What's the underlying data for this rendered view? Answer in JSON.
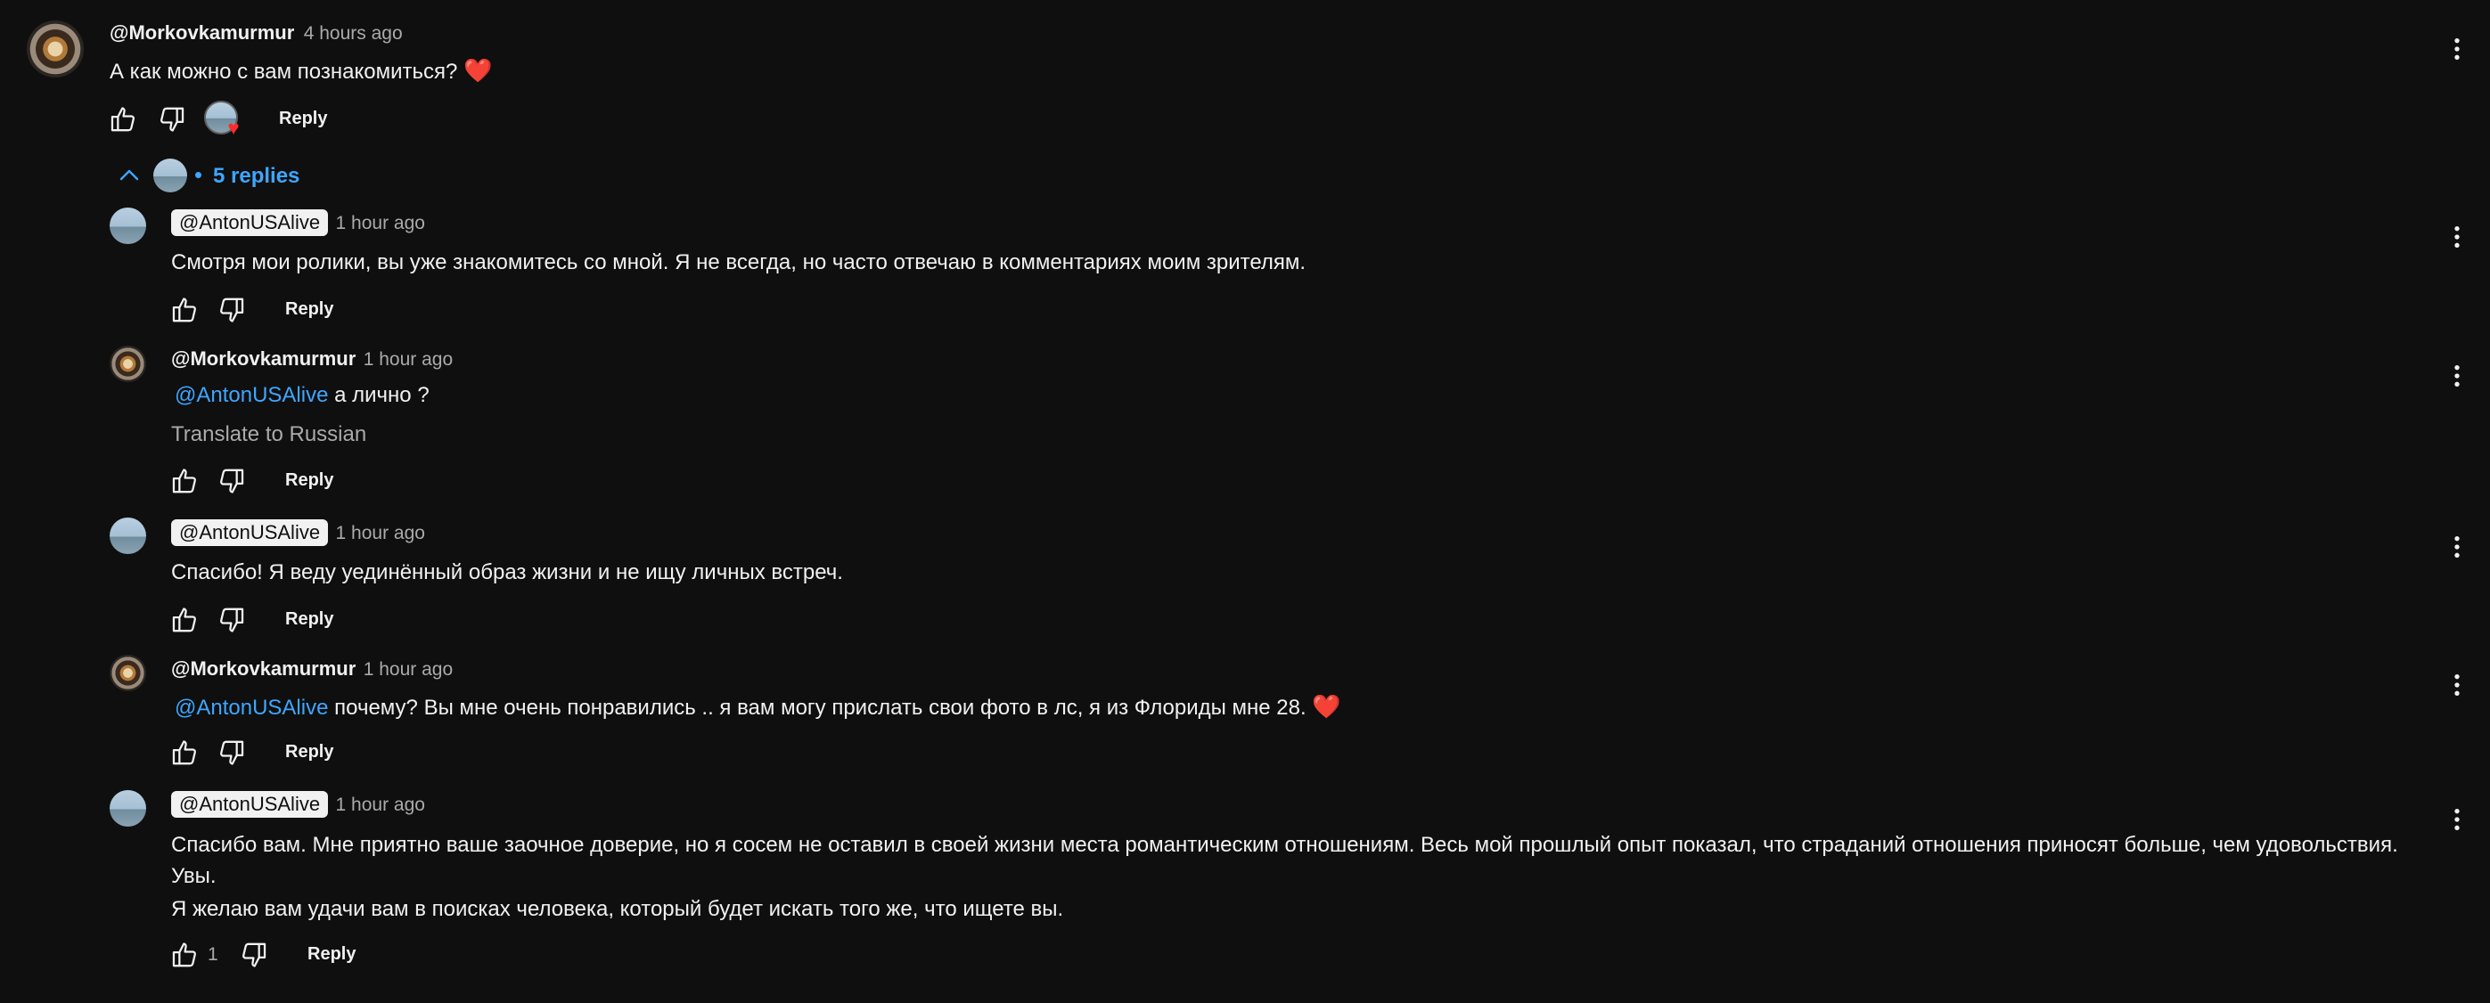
{
  "top_comment": {
    "author": "@Morkovkamurmur",
    "time": "4 hours ago",
    "text": "А как можно с вам познакомиться?",
    "emoji": "❤️",
    "reply_label": "Reply"
  },
  "replies_toggle": {
    "label": "5 replies"
  },
  "replies": [
    {
      "author": "@AntonUSAlive",
      "time": "1 hour ago",
      "text": "Смотря мои ролики, вы уже знакомитесь со мной. Я не всегда, но часто отвечаю в комментариях моим зрителям.",
      "reply_label": "Reply"
    },
    {
      "author": "@Morkovkamurmur",
      "time": "1 hour ago",
      "mention": "@AntonUSAlive",
      "text": " а лично ?",
      "translate": "Translate to Russian",
      "reply_label": "Reply"
    },
    {
      "author": "@AntonUSAlive",
      "time": "1 hour ago",
      "text": "Спасибо! Я веду уединённый образ жизни и не ищу личных встреч.",
      "reply_label": "Reply"
    },
    {
      "author": "@Morkovkamurmur",
      "time": "1 hour ago",
      "mention": "@AntonUSAlive",
      "text": " почему? Вы мне очень понравились .. я вам могу прислать свои фото в лс, я из Флориды мне 28.",
      "emoji": "❤️",
      "reply_label": "Reply"
    },
    {
      "author": "@AntonUSAlive",
      "time": "1 hour ago",
      "text_line1": "Спасибо вам. Мне приятно ваше заочное доверие, но я сосем не оставил в своей жизни места романтическим отношениям. Весь мой прошлый опыт показал, что страданий отношения приносят больше, чем удовольствия.",
      "text_line2": "Увы.",
      "text_line3": "Я желаю вам удачи вам в поисках человека, который будет искать того же, что ищете вы.",
      "like_count": "1",
      "reply_label": "Reply"
    }
  ],
  "icons": {
    "like": "thumb-up-icon",
    "dislike": "thumb-down-icon",
    "more": "more-vert-icon",
    "collapse": "chevron-up-icon",
    "creator_heart": "creator-heart-icon"
  },
  "colors": {
    "background": "#0f0f0f",
    "text": "#f1f1f1",
    "secondary": "#aaaaaa",
    "link": "#3ea6ff",
    "heart": "#ff2b2b"
  }
}
